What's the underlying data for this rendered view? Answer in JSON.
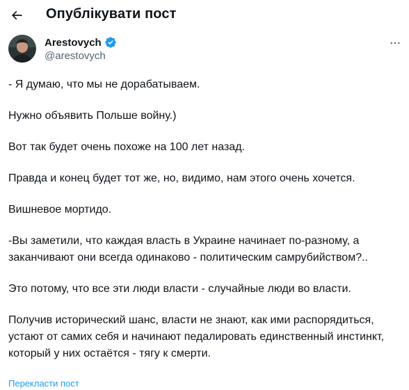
{
  "header": {
    "back_icon": "arrow-left-icon",
    "title": "Опублікувати пост"
  },
  "author": {
    "display_name": "Arestovych",
    "handle": "@arestovych",
    "verified_icon": "verified-badge-icon",
    "verified_color": "#1d9bf0",
    "more_icon": "more-horizontal-icon"
  },
  "post": {
    "paragraphs": [
      "- Я думаю, что мы не дорабатываем.",
      "Нужно объявить Польше войну.)",
      "Вот так будет очень похоже на 100 лет назад.",
      "Правда и конец будет тот же, но, видимо, нам этого очень хочется.",
      "Вишневое мортидо.",
      "-Вы заметили, что каждая власть в Украине начинает по-разному, а заканчивают они всегда одинаково - политическим самрубийством?..",
      "Это потому, что все эти люди власти - случайные люди во власти.",
      "Получив исторический шанс, власти не знают, как ими распорядиться, устают от самих себя и начинают педалировать единственный инстинкт, который у них остаётся - тягу к смерти."
    ],
    "translate_label": "Перекласти пост"
  },
  "colors": {
    "text": "#0f1419",
    "secondary": "#536471",
    "link": "#1d9bf0"
  }
}
